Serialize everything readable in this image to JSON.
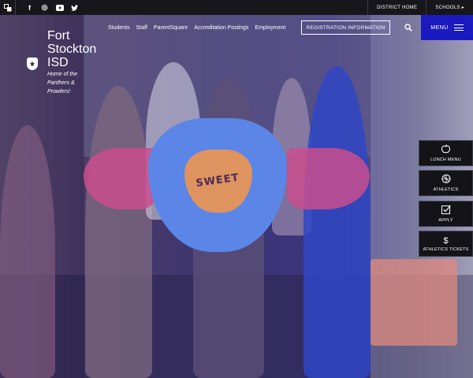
{
  "topbar": {
    "translate_icon": "translate-icon",
    "social": [
      {
        "name": "facebook-icon",
        "glyph": "f"
      },
      {
        "name": "instagram-icon",
        "glyph": "◎"
      },
      {
        "name": "youtube-icon",
        "glyph": "▶"
      },
      {
        "name": "twitter-icon",
        "glyph": "🐦"
      }
    ],
    "district_home": "DISTRICT HOME",
    "schools": "SCHOOLS",
    "schools_caret": "▸"
  },
  "header": {
    "site_name": "Fort Stockton ISD",
    "tagline": "Home of the Panthers & Prowlers!",
    "nav": [
      "Students",
      "Staff",
      "ParentSquare",
      "Accreditation Postings",
      "Employment"
    ],
    "registration_button": "REGISTRATION INFORMATION",
    "menu_label": "MENU",
    "search_icon": "search-icon"
  },
  "hero": {
    "poster_text": "SWEET"
  },
  "quick_links": [
    {
      "label": "LUNCH MENU",
      "icon": "apple-icon",
      "glyph": "🍎"
    },
    {
      "label": "ATHLETICS",
      "icon": "ball-icon",
      "glyph": "⚽"
    },
    {
      "label": "APPLY",
      "icon": "checkbox-icon",
      "glyph": "☑"
    },
    {
      "label": "ATHLETICS TICKETS",
      "icon": "dollar-icon",
      "glyph": "$"
    }
  ],
  "colors": {
    "topbar": "#17171b",
    "menu": "#1a1ac0",
    "quick_link_bg": "#141418"
  }
}
